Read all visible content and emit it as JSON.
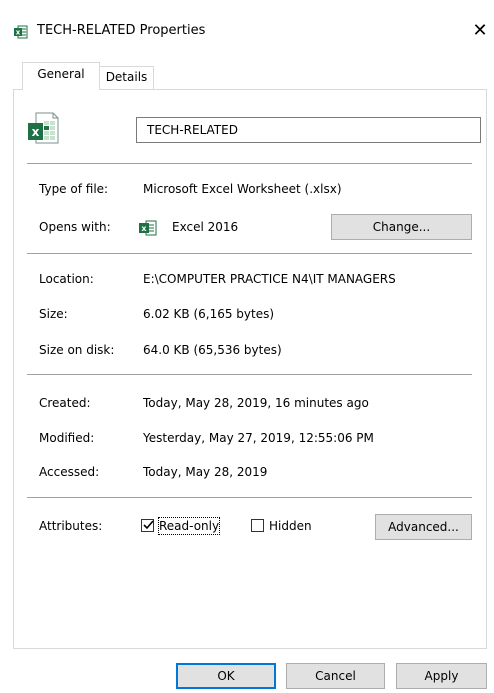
{
  "window": {
    "title": "TECH-RELATED Properties",
    "close_glyph": "✕"
  },
  "tabs": [
    {
      "label": "General",
      "active": true
    },
    {
      "label": "Details",
      "active": false
    }
  ],
  "general": {
    "file_icon": "excel-file-icon",
    "file_name": "TECH-RELATED",
    "type_label": "Type of file:",
    "type_value": "Microsoft Excel Worksheet (.xlsx)",
    "opens_label": "Opens with:",
    "opens_icon": "excel-app-icon",
    "opens_value": "Excel 2016",
    "change_button": "Change...",
    "location_label": "Location:",
    "location_value": "E:\\COMPUTER PRACTICE N4\\IT MANAGERS",
    "size_label": "Size:",
    "size_value": "6.02 KB (6,165 bytes)",
    "size_disk_label": "Size on disk:",
    "size_disk_value": "64.0 KB (65,536 bytes)",
    "created_label": "Created:",
    "created_value": "Today, May 28, 2019, 16 minutes ago",
    "modified_label": "Modified:",
    "modified_value": "Yesterday, May 27, 2019, 12:55:06 PM",
    "accessed_label": "Accessed:",
    "accessed_value": "Today, May 28, 2019",
    "attributes_label": "Attributes:",
    "readonly_label": "Read-only",
    "readonly_checked": true,
    "hidden_label": "Hidden",
    "hidden_checked": false,
    "advanced_button": "Advanced..."
  },
  "footer": {
    "ok_button": "OK",
    "cancel_button": "Cancel",
    "apply_button": "Apply"
  },
  "colors": {
    "excel_green": "#1e7145",
    "accent_blue": "#0078d7",
    "button_face": "#e1e1e1"
  }
}
